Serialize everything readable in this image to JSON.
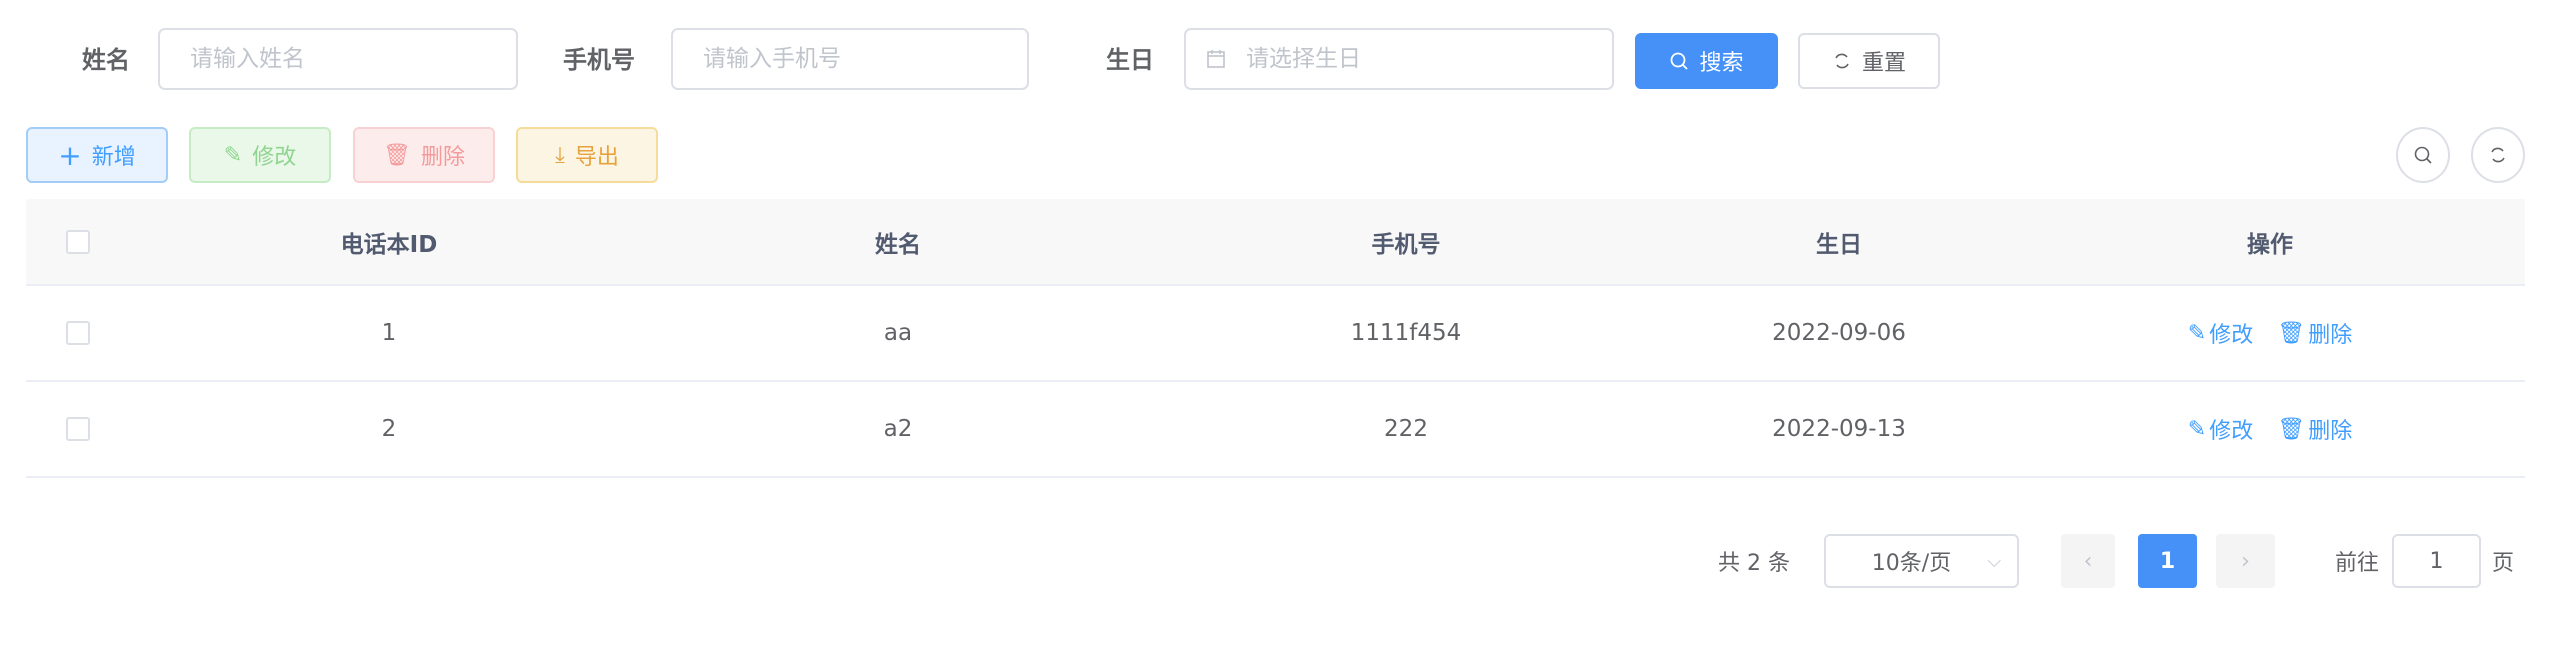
{
  "search": {
    "name_label": "姓名",
    "name_placeholder": "请输入姓名",
    "phone_label": "手机号",
    "phone_placeholder": "请输入手机号",
    "birthday_label": "生日",
    "birthday_placeholder": "请选择生日",
    "search_button": "搜索",
    "reset_button": "重置"
  },
  "toolbar": {
    "add": "新增",
    "edit": "修改",
    "delete": "删除",
    "export": "导出"
  },
  "colors": {
    "primary": "#409eff",
    "success": "#67c23a",
    "danger": "#f56c6c",
    "warning": "#e6a23c"
  },
  "table": {
    "columns": [
      "电话本ID",
      "姓名",
      "手机号",
      "生日",
      "操作"
    ],
    "rows": [
      {
        "id": "1",
        "name": "aa",
        "phone": "1111f454",
        "birthday": "2022-09-06"
      },
      {
        "id": "2",
        "name": "a2",
        "phone": "222",
        "birthday": "2022-09-13"
      }
    ],
    "row_actions": {
      "edit": "修改",
      "delete": "删除"
    }
  },
  "pagination": {
    "total": "共 2 条",
    "page_size": "10条/页",
    "current_page": "1",
    "goto_label": "前往",
    "goto_value": "1",
    "page_suffix": "页"
  }
}
